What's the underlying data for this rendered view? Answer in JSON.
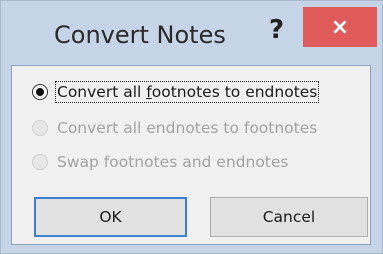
{
  "dialog": {
    "title": "Convert Notes",
    "help_label": "?",
    "close_label": "×"
  },
  "options": [
    {
      "prefix": "Convert all ",
      "mnemonic": "f",
      "suffix": "ootnotes to endnotes",
      "checked": true,
      "enabled": true
    },
    {
      "label": "Convert all endnotes to footnotes",
      "checked": false,
      "enabled": false
    },
    {
      "label": "Swap footnotes and endnotes",
      "checked": false,
      "enabled": false
    }
  ],
  "buttons": {
    "ok_label": "OK",
    "cancel_label": "Cancel"
  },
  "colors": {
    "window_bg": "#c5d5e7",
    "close_bg": "#df5b5c",
    "default_button_border": "#3c7fd1",
    "disabled_text": "#a2a2a2"
  }
}
